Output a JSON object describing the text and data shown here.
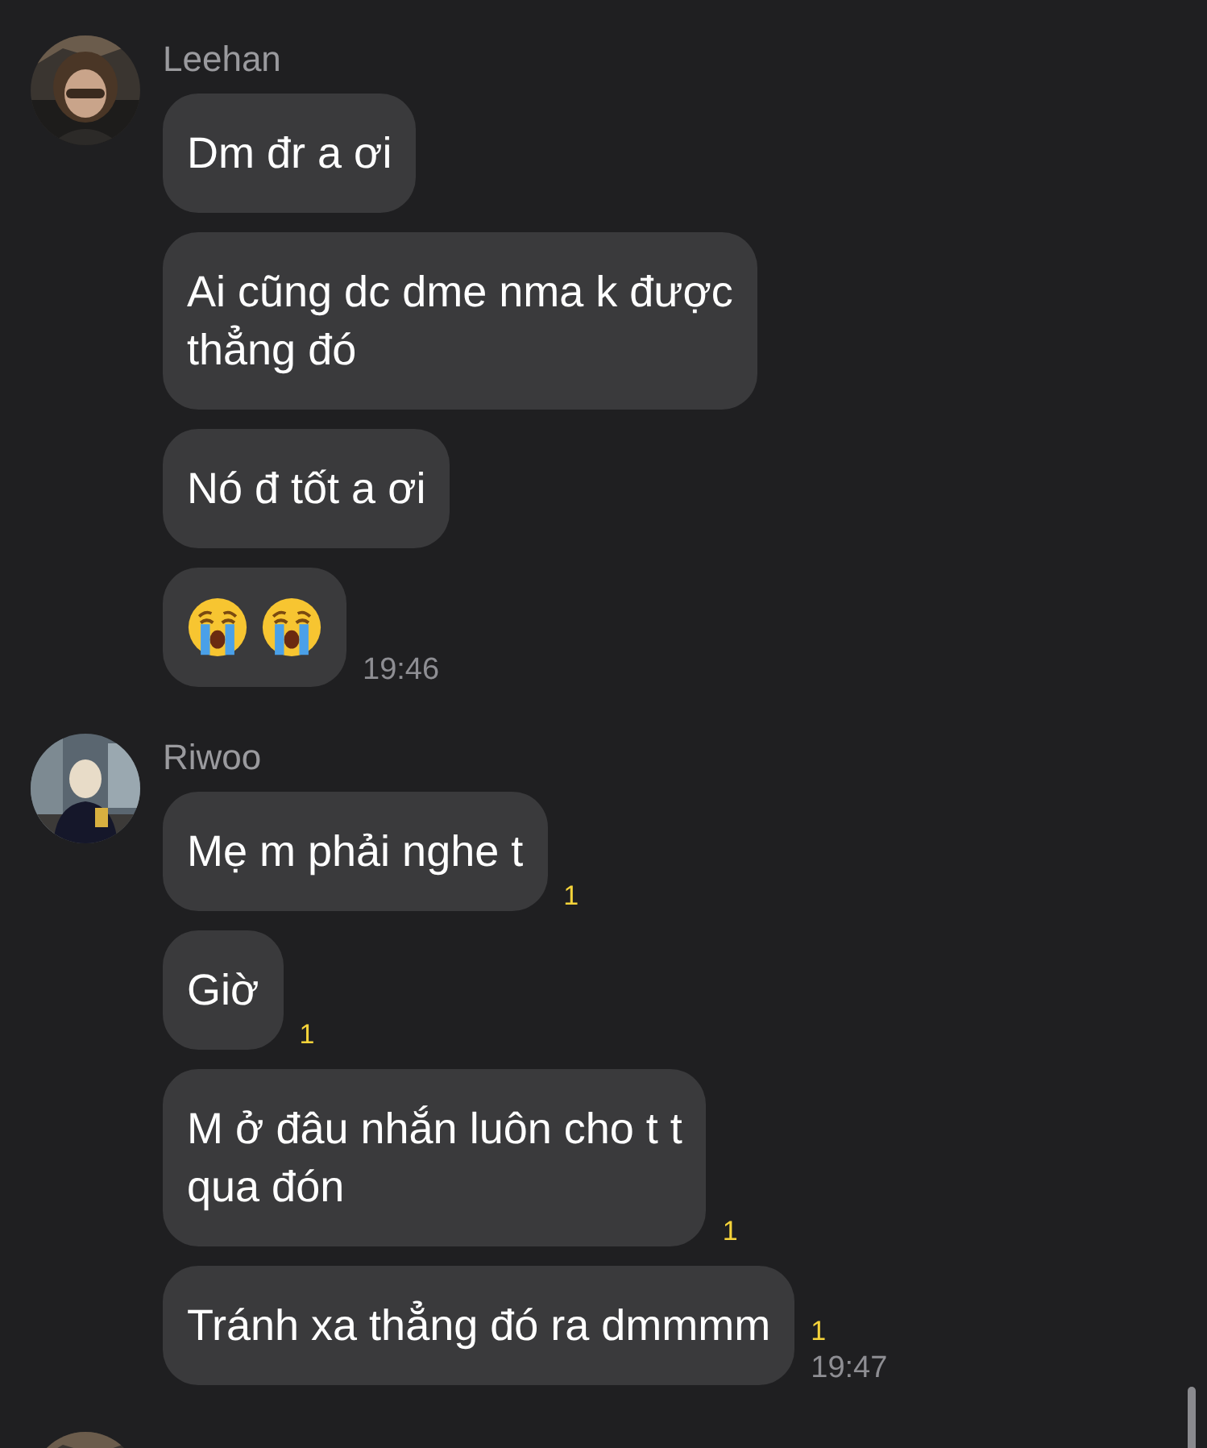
{
  "groups": [
    {
      "avatar": {
        "kind": "picture"
      },
      "sender": "Leehan",
      "messages": [
        {
          "kind": "text",
          "text": "Dm đr a ơi"
        },
        {
          "kind": "text",
          "text": "Ai cũng dc dme nma k được\nthẳng đó"
        },
        {
          "kind": "text",
          "text": "Nó đ tốt a ơi"
        },
        {
          "kind": "emoji",
          "emojis": [
            {
              "kind": "crying"
            },
            {
              "kind": "crying"
            }
          ],
          "time": "19:46"
        }
      ]
    },
    {
      "avatar": {
        "kind": "picture"
      },
      "sender": "Riwoo",
      "messages": [
        {
          "kind": "text",
          "text": "Mẹ m phải nghe t",
          "unread": "1"
        },
        {
          "kind": "text",
          "text": "Giờ",
          "unread": "1"
        },
        {
          "kind": "text",
          "text": "M ở đâu nhắn luôn cho t t\nqua đón",
          "unread": "1"
        },
        {
          "kind": "text",
          "text": "Tránh xa thẳng đó ra dmmmm",
          "unread": "1",
          "time": "19:47"
        }
      ]
    },
    {
      "avatar": {
        "kind": "picture"
      }
    }
  ]
}
